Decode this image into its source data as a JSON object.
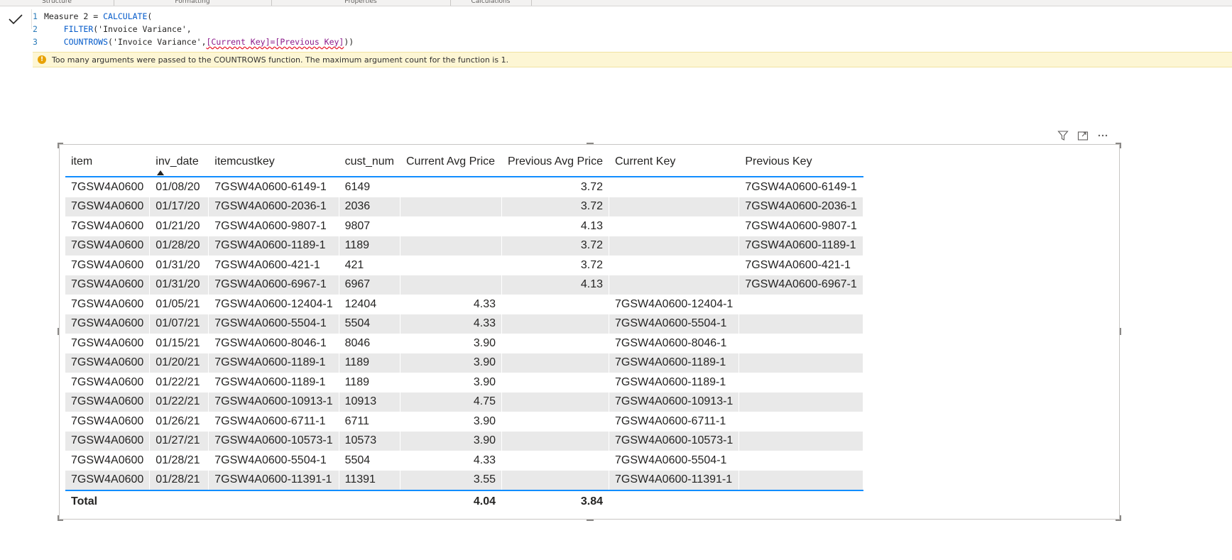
{
  "ribbon": {
    "groups": [
      "Structure",
      "Formatting",
      "Properties",
      "Calculations"
    ]
  },
  "formula_bar": {
    "line_numbers": [
      "1",
      "2",
      "3"
    ],
    "line1": {
      "measure": "Measure 2 = ",
      "func": "CALCULATE",
      "rest": "("
    },
    "line2": {
      "func": "FILTER",
      "arg": "('Invoice Variance',",
      "indent": "    "
    },
    "line3": {
      "func": "COUNTROWS",
      "arg": "('Invoice Variance',",
      "flagged": "[Current Key]=[Previous Key]",
      "close": "))",
      "indent": "    "
    },
    "error_message": "Too many arguments were passed to the COUNTROWS function. The maximum argument count for the function is 1."
  },
  "table": {
    "columns": [
      "item",
      "inv_date",
      "itemcustkey",
      "cust_num",
      "Current Avg Price",
      "Previous Avg Price",
      "Current Key",
      "Previous Key"
    ],
    "rows": [
      [
        "7GSW4A0600",
        "01/08/20",
        "7GSW4A0600-6149-1",
        "6149",
        "",
        "3.72",
        "",
        "7GSW4A0600-6149-1"
      ],
      [
        "7GSW4A0600",
        "01/17/20",
        "7GSW4A0600-2036-1",
        "2036",
        "",
        "3.72",
        "",
        "7GSW4A0600-2036-1"
      ],
      [
        "7GSW4A0600",
        "01/21/20",
        "7GSW4A0600-9807-1",
        "9807",
        "",
        "4.13",
        "",
        "7GSW4A0600-9807-1"
      ],
      [
        "7GSW4A0600",
        "01/28/20",
        "7GSW4A0600-1189-1",
        "1189",
        "",
        "3.72",
        "",
        "7GSW4A0600-1189-1"
      ],
      [
        "7GSW4A0600",
        "01/31/20",
        "7GSW4A0600-421-1",
        "421",
        "",
        "3.72",
        "",
        "7GSW4A0600-421-1"
      ],
      [
        "7GSW4A0600",
        "01/31/20",
        "7GSW4A0600-6967-1",
        "6967",
        "",
        "4.13",
        "",
        "7GSW4A0600-6967-1"
      ],
      [
        "7GSW4A0600",
        "01/05/21",
        "7GSW4A0600-12404-1",
        "12404",
        "4.33",
        "",
        "7GSW4A0600-12404-1",
        ""
      ],
      [
        "7GSW4A0600",
        "01/07/21",
        "7GSW4A0600-5504-1",
        "5504",
        "4.33",
        "",
        "7GSW4A0600-5504-1",
        ""
      ],
      [
        "7GSW4A0600",
        "01/15/21",
        "7GSW4A0600-8046-1",
        "8046",
        "3.90",
        "",
        "7GSW4A0600-8046-1",
        ""
      ],
      [
        "7GSW4A0600",
        "01/20/21",
        "7GSW4A0600-1189-1",
        "1189",
        "3.90",
        "",
        "7GSW4A0600-1189-1",
        ""
      ],
      [
        "7GSW4A0600",
        "01/22/21",
        "7GSW4A0600-1189-1",
        "1189",
        "3.90",
        "",
        "7GSW4A0600-1189-1",
        ""
      ],
      [
        "7GSW4A0600",
        "01/22/21",
        "7GSW4A0600-10913-1",
        "10913",
        "4.75",
        "",
        "7GSW4A0600-10913-1",
        ""
      ],
      [
        "7GSW4A0600",
        "01/26/21",
        "7GSW4A0600-6711-1",
        "6711",
        "3.90",
        "",
        "7GSW4A0600-6711-1",
        ""
      ],
      [
        "7GSW4A0600",
        "01/27/21",
        "7GSW4A0600-10573-1",
        "10573",
        "3.90",
        "",
        "7GSW4A0600-10573-1",
        ""
      ],
      [
        "7GSW4A0600",
        "01/28/21",
        "7GSW4A0600-5504-1",
        "5504",
        "4.33",
        "",
        "7GSW4A0600-5504-1",
        ""
      ],
      [
        "7GSW4A0600",
        "01/28/21",
        "7GSW4A0600-11391-1",
        "11391",
        "3.55",
        "",
        "7GSW4A0600-11391-1",
        ""
      ]
    ],
    "total": {
      "label": "Total",
      "current_avg_price": "4.04",
      "previous_avg_price": "3.84"
    },
    "sorted_column": "inv_date",
    "sort_direction": "ascending"
  },
  "colors": {
    "accent": "#118dff",
    "alt_row": "#e9e9e9",
    "warning_bg": "#fdf6d4",
    "warning_icon": "#e8a202",
    "dax_keyword": "#035aca"
  },
  "icons": [
    "commit-checkmark-icon",
    "warning-icon",
    "filter-icon",
    "focus-mode-icon",
    "more-options-icon",
    "sort-ascending-icon"
  ]
}
